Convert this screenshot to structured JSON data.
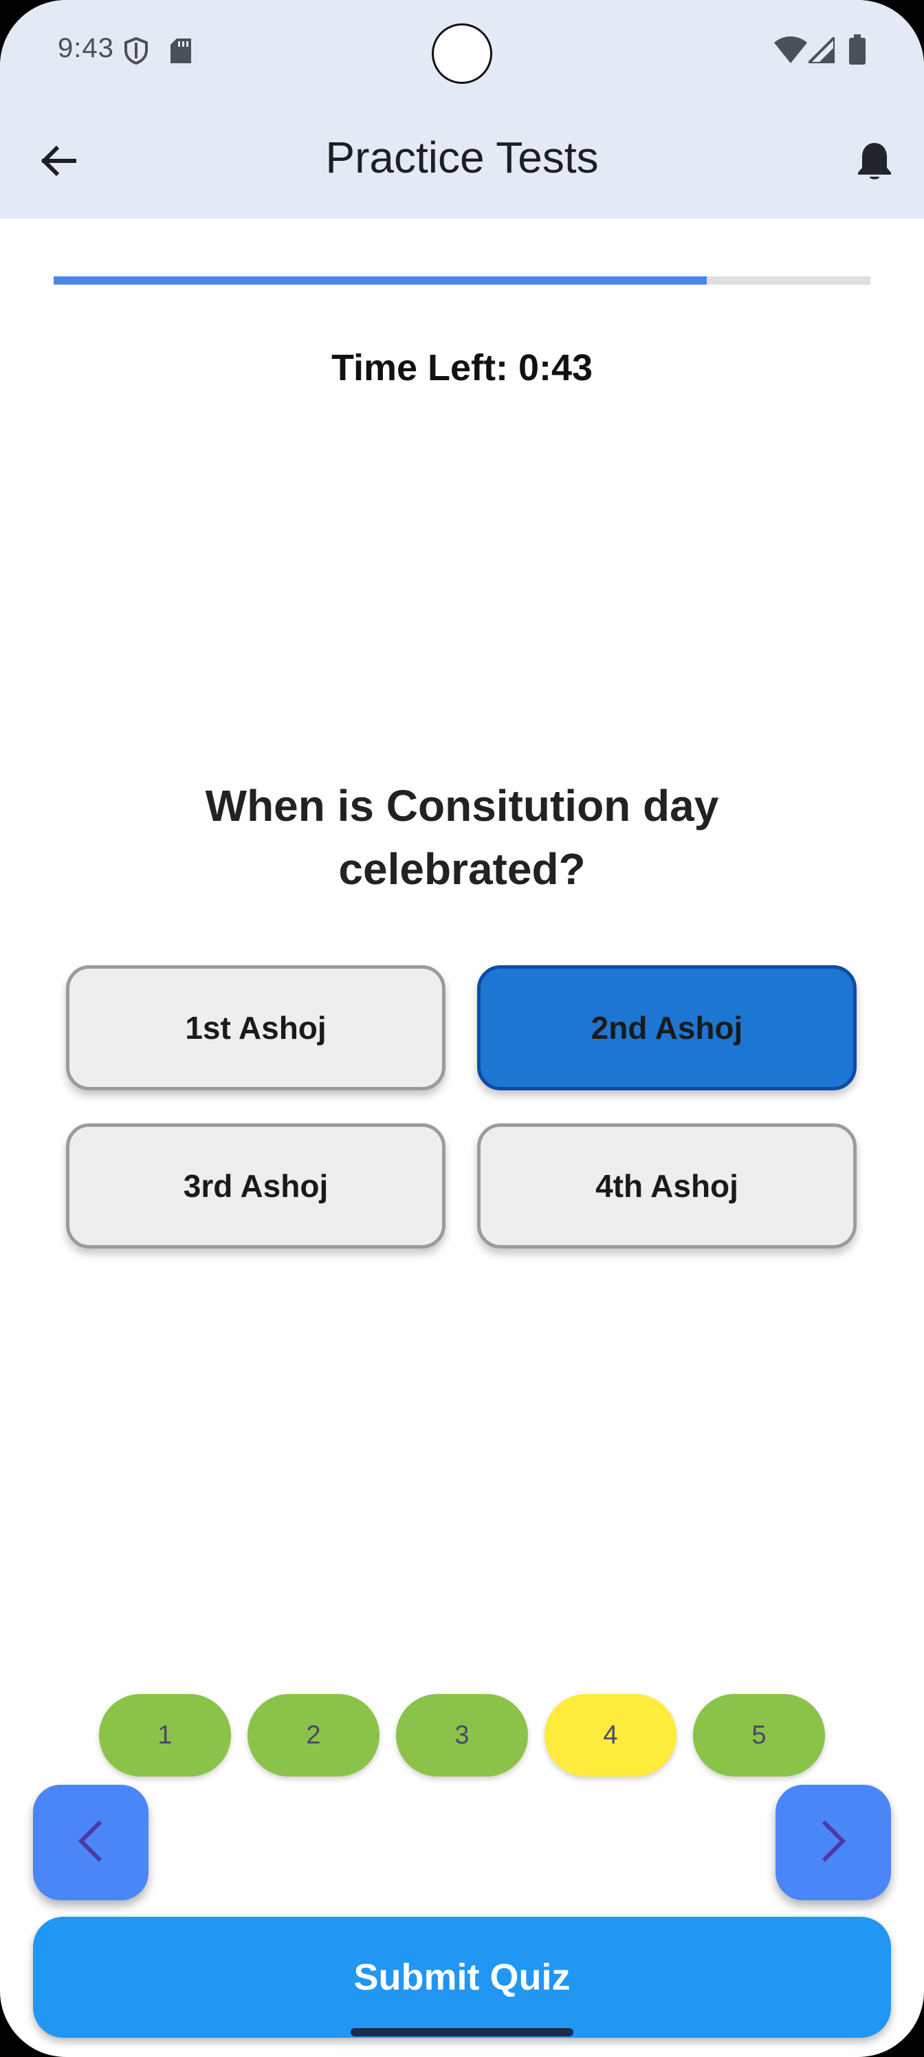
{
  "status_bar": {
    "time": "9:43",
    "icons": [
      "shield-icon",
      "sd-card-icon",
      "wifi-icon",
      "signal-icon",
      "battery-icon"
    ]
  },
  "app_bar": {
    "title": "Practice Tests",
    "back_icon": "arrow-left-icon",
    "action_icon": "bell-icon",
    "background": "#e3e9f5"
  },
  "quiz": {
    "progress": 0.8,
    "progress_color": "#4a86ea",
    "time_left": "Time Left: 0:43",
    "question": "When is Consitution day celebrated?",
    "options": [
      {
        "label": "1st Ashoj",
        "selected": false
      },
      {
        "label": "2nd Ashoj",
        "selected": true
      },
      {
        "label": "3rd Ashoj",
        "selected": false
      },
      {
        "label": "4th Ashoj",
        "selected": false
      }
    ],
    "question_nav": [
      {
        "label": "1",
        "color": "#8bc34a"
      },
      {
        "label": "2",
        "color": "#8bc34a"
      },
      {
        "label": "3",
        "color": "#8bc34a"
      },
      {
        "label": "4",
        "color": "#ffeb3b"
      },
      {
        "label": "5",
        "color": "#8bc34a"
      }
    ],
    "prev_icon": "chevron-left-icon",
    "next_icon": "chevron-right-icon",
    "submit_label": "Submit Quiz",
    "selected_color": "#1d76d2",
    "submit_color": "#2196f3"
  }
}
